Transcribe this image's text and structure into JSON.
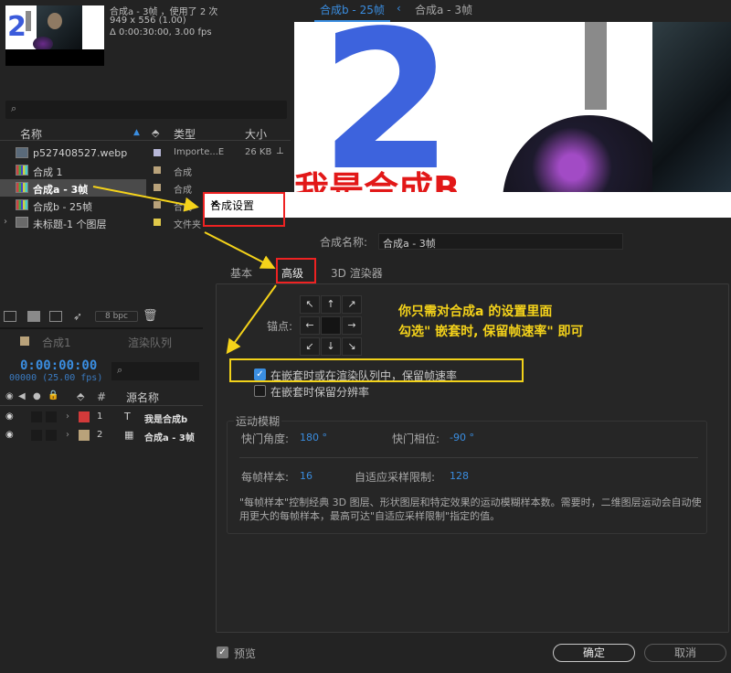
{
  "project": {
    "thumb_info": {
      "name": "合成a - 3帧 ，使用了 2 次",
      "dims": "949 x 556 (1.00)",
      "duration": "Δ 0:00:30:00, 3.00 fps"
    },
    "search_placeholder": "⌕",
    "columns": {
      "name": "名称",
      "type": "类型",
      "size": "大小"
    },
    "items": [
      {
        "name": "p527408527.webp",
        "type": "Importe...E",
        "size": "26 KB",
        "color": "#b7b7d8",
        "icon": "image-icon"
      },
      {
        "name": "合成 1",
        "type": "合成",
        "size": "",
        "color": "#b9a27a",
        "icon": "comp-icon"
      },
      {
        "name": "合成a - 3帧",
        "type": "合成",
        "size": "",
        "color": "#b9a27a",
        "icon": "comp-icon",
        "selected": true
      },
      {
        "name": "合成b - 25帧",
        "type": "合成",
        "size": "",
        "color": "#b9a27a",
        "icon": "comp-icon"
      },
      {
        "name": "未标题-1 个图层",
        "type": "文件夹",
        "size": "",
        "color": "#e0c94a",
        "icon": "folder-icon"
      }
    ],
    "bpc": "8 bpc"
  },
  "timeline": {
    "tab1": "合成1",
    "tab2": "渲染队列",
    "timecode": "0:00:00:00",
    "timecode_sub": "00000 (25.00 fps)",
    "search_placeholder": "⌕",
    "hash": "#",
    "source_header": "源名称",
    "layers": [
      {
        "num": "1",
        "type_icon": "T",
        "name": "我是合成b",
        "color": "#d23a3a"
      },
      {
        "num": "2",
        "type_icon": "▦",
        "name": "合成a - 3帧",
        "color": "#b9a27a"
      }
    ]
  },
  "viewer": {
    "tab_active": "合成b - 25帧",
    "tab_prev": "‹",
    "tab_other": "合成a - 3帧",
    "big_number": "2",
    "red_text": "我是合成B"
  },
  "dialog": {
    "title": "合成设置",
    "name_label": "合成名称:",
    "name_value": "合成a - 3帧",
    "tabs": {
      "basic": "基本",
      "advanced": "高级",
      "renderer": "3D 渲染器"
    },
    "anchor_label": "锚点:",
    "anchor_arrows": [
      "↖",
      "↑",
      "↗",
      "←",
      "",
      "→",
      "↙",
      "↓",
      "↘"
    ],
    "checkbox_preserve_framerate": {
      "label": "在嵌套时或在渲染队列中，保留帧速率",
      "checked": true
    },
    "checkbox_preserve_resolution": {
      "label": "在嵌套时保留分辨率",
      "checked": false
    },
    "motion_blur": {
      "legend": "运动模糊",
      "shutter_angle_label": "快门角度:",
      "shutter_angle_value": "180 °",
      "shutter_phase_label": "快门相位:",
      "shutter_phase_value": "-90 °",
      "samples_label": "每帧样本:",
      "samples_value": "16",
      "adaptive_label": "自适应采样限制:",
      "adaptive_value": "128",
      "description": "\"每帧样本\"控制经典 3D 图层、形状图层和特定效果的运动模糊样本数。需要时，二维图层运动会自动使用更大的每帧样本，最高可达\"自适应采样限制\"指定的值。"
    },
    "preview_label": "预览",
    "ok": "确定",
    "cancel": "取消"
  },
  "annotation": {
    "line1": "你只需对合成a 的设置里面",
    "line2": "勾选\" 嵌套时, 保留帧速率\" 即可",
    "color": "#f5d31a"
  }
}
